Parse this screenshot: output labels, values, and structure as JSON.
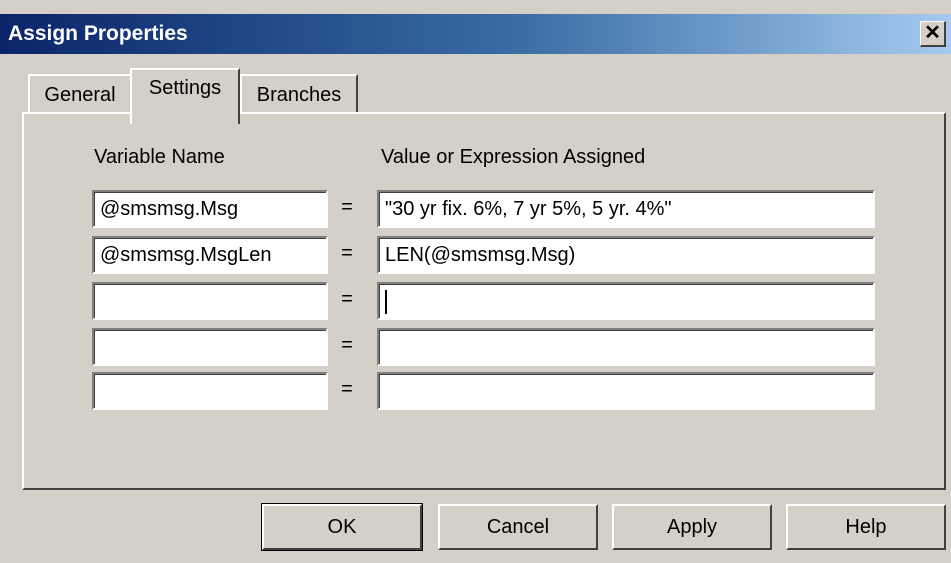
{
  "window": {
    "title": "Assign Properties",
    "close_glyph": "✕"
  },
  "tabs": [
    {
      "label": "General"
    },
    {
      "label": "Settings",
      "selected": true
    },
    {
      "label": "Branches"
    }
  ],
  "settings": {
    "variable_header": "Variable Name",
    "value_header": "Value or Expression Assigned",
    "equals": "=",
    "rows": [
      {
        "variable": "@smsmsg.Msg",
        "value": "\"30 yr fix. 6%,  7 yr 5%, 5 yr. 4%\""
      },
      {
        "variable": "@smsmsg.MsgLen",
        "value": "LEN(@smsmsg.Msg)"
      },
      {
        "variable": "",
        "value": ""
      },
      {
        "variable": "",
        "value": ""
      },
      {
        "variable": "",
        "value": ""
      }
    ]
  },
  "buttons": {
    "ok": "OK",
    "cancel": "Cancel",
    "apply": "Apply",
    "help": "Help"
  }
}
